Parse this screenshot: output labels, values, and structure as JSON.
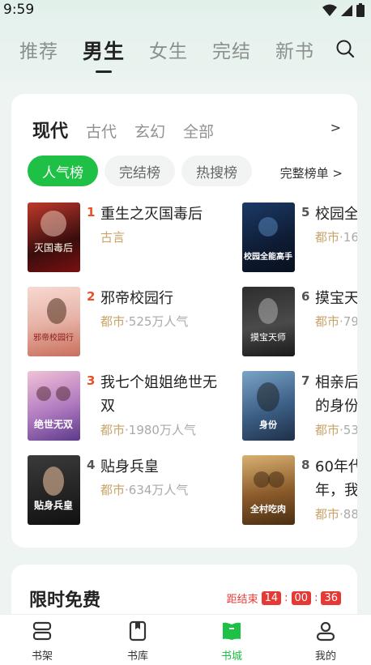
{
  "status": {
    "time": "9:59"
  },
  "header": {
    "tabs": [
      "推荐",
      "男生",
      "女生",
      "完结",
      "新书"
    ],
    "active_tab": "男生"
  },
  "ranking": {
    "categories": [
      "现代",
      "古代",
      "玄幻",
      "全部"
    ],
    "more_arrow": ">",
    "chips": [
      "人气榜",
      "完结榜",
      "热搜榜"
    ],
    "full_list": "完整榜单 >",
    "books_left": [
      {
        "rank": "1",
        "title": "重生之灭国毒后",
        "genre": "古言",
        "pop": "",
        "cover_text": "灭国毒后"
      },
      {
        "rank": "2",
        "title": "邪帝校园行",
        "genre": "都市",
        "pop": "·525万人气",
        "cover_text": "邪帝校园行"
      },
      {
        "rank": "3",
        "title": "我七个姐姐绝世无双",
        "genre": "都市",
        "pop": "·1980万人气",
        "cover_text": "绝世无双"
      },
      {
        "rank": "4",
        "title": "贴身兵皇",
        "genre": "都市",
        "pop": "·634万人气",
        "cover_text": "贴身兵皇"
      }
    ],
    "books_right": [
      {
        "rank": "5",
        "title": "校园全",
        "genre": "都市",
        "pop": "·16",
        "cover_text": "校园全能高手"
      },
      {
        "rank": "6",
        "title": "摸宝天",
        "genre": "都市",
        "pop": "·79",
        "cover_text": "摸宝天师"
      },
      {
        "rank": "7",
        "title": "相亲后的身份",
        "genre": "都市",
        "pop": "·53",
        "cover_text": "身份"
      },
      {
        "rank": "8",
        "title": "60年代年，我",
        "genre": "都市",
        "pop": "·88",
        "cover_text": "全村吃肉"
      }
    ]
  },
  "free": {
    "title": "限时免费",
    "countdown_label": "距结束",
    "hours": "14",
    "minutes": "00",
    "seconds": "36",
    "sep": ":"
  },
  "nav": [
    "书架",
    "书库",
    "书城",
    "我的"
  ],
  "colors": {
    "accent": "#1ec145",
    "rank_red": "#e8502a",
    "rank_gray": "#555555",
    "genre": "#c9a36a",
    "countdown": "#e53935"
  }
}
